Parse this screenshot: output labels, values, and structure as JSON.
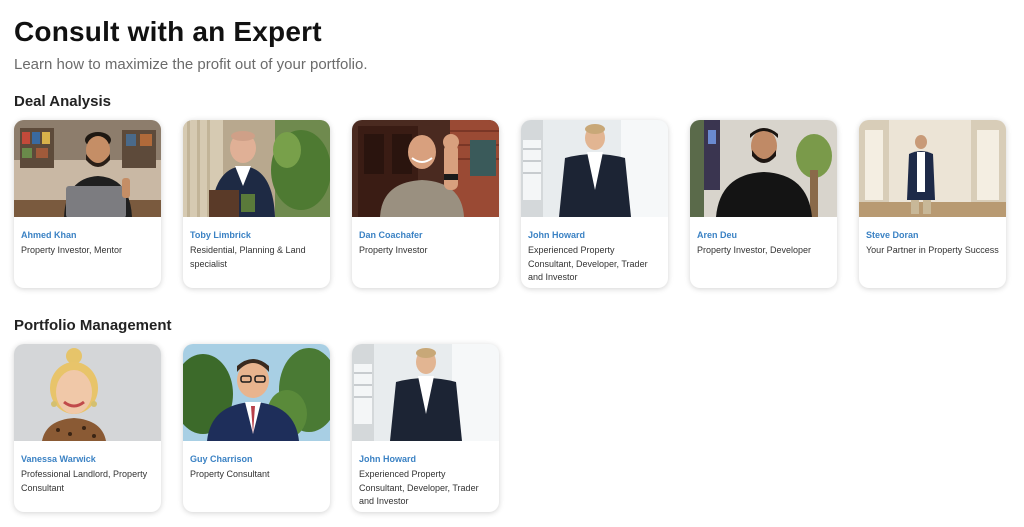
{
  "page": {
    "title": "Consult with an Expert",
    "subtitle": "Learn how to maximize the profit out of your portfolio."
  },
  "sections": [
    {
      "heading": "Deal Analysis",
      "experts": [
        {
          "name": "Ahmed Khan",
          "role": "Property Investor, Mentor"
        },
        {
          "name": "Toby Limbrick",
          "role": "Residential, Planning & Land specialist"
        },
        {
          "name": "Dan Coachafer",
          "role": "Property Investor"
        },
        {
          "name": "John Howard",
          "role": "Experienced Property Consultant, Developer, Trader and Investor"
        },
        {
          "name": "Aren Deu",
          "role": "Property Investor, Developer"
        },
        {
          "name": "Steve Doran",
          "role": "Your Partner in Property Success"
        }
      ]
    },
    {
      "heading": "Portfolio Management",
      "experts": [
        {
          "name": "Vanessa Warwick",
          "role": "Professional Landlord, Property Consultant"
        },
        {
          "name": "Guy Charrison",
          "role": "Property Consultant"
        },
        {
          "name": "John Howard",
          "role": "Experienced Property Consultant, Developer, Trader and Investor"
        }
      ]
    }
  ],
  "colors": {
    "expert_name": "#3b82c4",
    "title": "#111111",
    "subtitle": "#6b6b6b"
  }
}
